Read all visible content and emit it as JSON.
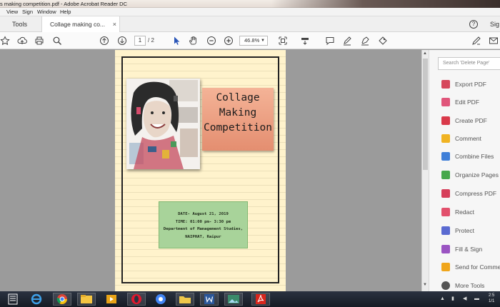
{
  "window": {
    "title": "s making competition.pdf - Adobe Acrobat Reader DC"
  },
  "menu": [
    "View",
    "Sign",
    "Window",
    "Help"
  ],
  "tabs": {
    "tools": "Tools",
    "document": "Collage making co...",
    "close": "×",
    "help": "?",
    "sign": "Sig"
  },
  "toolbar": {
    "current_page": "1",
    "page_count": "/ 2",
    "zoom": "46.8%"
  },
  "document": {
    "banner_lines": [
      "Collage",
      "Making",
      "Competition"
    ],
    "info_lines": [
      "DATE- August 21, 2019",
      "TIME: 01:00 pm- 3:30 pm",
      "Department of Management Studies,",
      "NAIPHAT, Raipur"
    ]
  },
  "right_pane": {
    "search_placeholder": "Search 'Delete Page'",
    "tools": [
      {
        "label": "Export PDF",
        "icon": "export-pdf-icon",
        "color": "#d6475b"
      },
      {
        "label": "Edit PDF",
        "icon": "edit-pdf-icon",
        "color": "#e0557a"
      },
      {
        "label": "Create PDF",
        "icon": "create-pdf-icon",
        "color": "#d9394a"
      },
      {
        "label": "Comment",
        "icon": "comment-icon",
        "color": "#f0b323"
      },
      {
        "label": "Combine Files",
        "icon": "combine-files-icon",
        "color": "#3f7fd8"
      },
      {
        "label": "Organize Pages",
        "icon": "organize-pages-icon",
        "color": "#46a84b"
      },
      {
        "label": "Compress PDF",
        "icon": "compress-pdf-icon",
        "color": "#d63f5a"
      },
      {
        "label": "Redact",
        "icon": "redact-icon",
        "color": "#e2506c"
      },
      {
        "label": "Protect",
        "icon": "protect-icon",
        "color": "#5a6ad1"
      },
      {
        "label": "Fill & Sign",
        "icon": "fill-sign-icon",
        "color": "#9a54c2"
      },
      {
        "label": "Send for Comme",
        "icon": "send-for-comments-icon",
        "color": "#f0a61c"
      },
      {
        "label": "More Tools",
        "icon": "more-tools-icon",
        "color": "#555555"
      }
    ]
  },
  "taskbar": {
    "clock_time": "2:5",
    "clock_date": "1/1"
  }
}
